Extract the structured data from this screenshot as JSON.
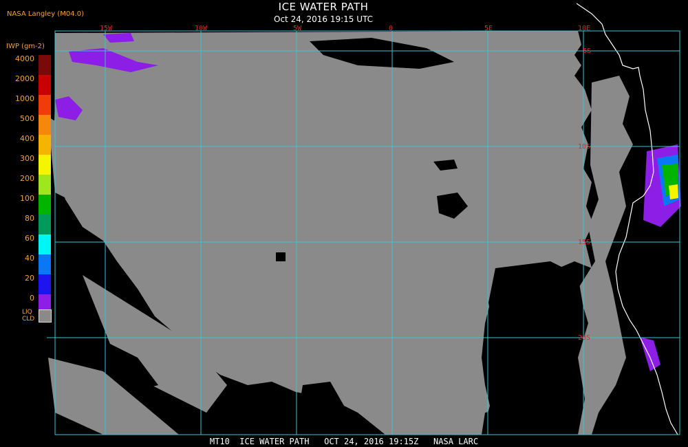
{
  "header": {
    "credit": "NASA Langley (M04.0)",
    "title": "ICE WATER PATH",
    "subtitle": "Oct 24, 2016 19:15 UTC"
  },
  "map": {
    "lon_labels": [
      "15W",
      "10W",
      "5W",
      "0",
      "5E",
      "10E"
    ],
    "lat_labels": [
      "5S",
      "10S",
      "15S",
      "20S"
    ],
    "colors": {
      "background": "#000000",
      "liquid_cloud": "#8a8a8a",
      "grid": "#37c7d3",
      "coastline": "#ffffff",
      "labels": "#e0282a"
    }
  },
  "colorbar": {
    "title": "IWP (gm-2)",
    "labels": [
      "4000",
      "2000",
      "1000",
      "500",
      "400",
      "300",
      "200",
      "100",
      "80",
      "60",
      "40",
      "20",
      "0"
    ],
    "colors": [
      "#7a0a0a",
      "#c80000",
      "#f03c0a",
      "#f5870a",
      "#f5b400",
      "#f5f500",
      "#a0e61e",
      "#00b400",
      "#009a5a",
      "#00f5f5",
      "#0a78f5",
      "#1e14f0",
      "#8c1ee6"
    ],
    "liq_label_line1": "LIQ",
    "liq_label_line2": "CLD"
  },
  "footer": {
    "text": "MT10  ICE WATER PATH   OCT 24, 2016 19:15Z   NASA LARC"
  }
}
